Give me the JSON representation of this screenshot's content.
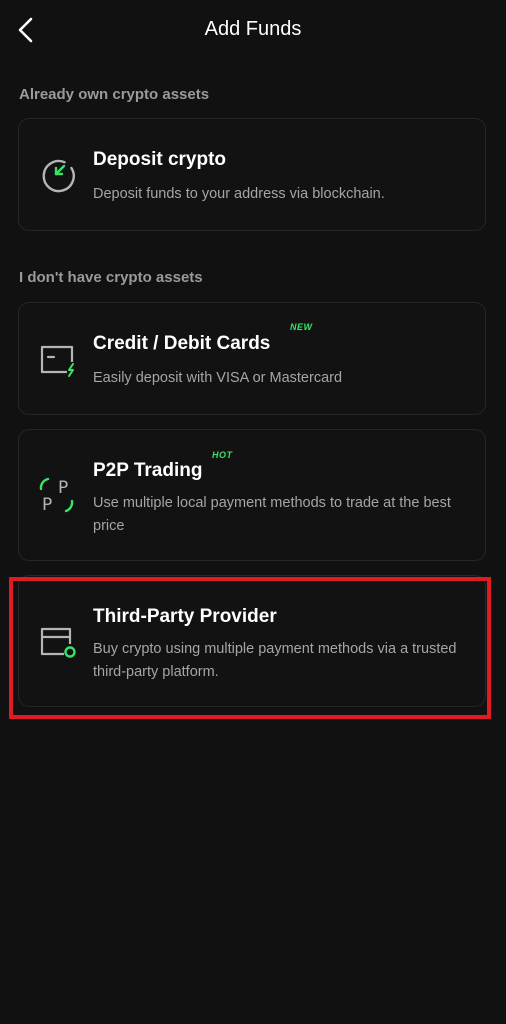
{
  "header": {
    "title": "Add Funds"
  },
  "sections": [
    {
      "label": "Already own crypto assets"
    },
    {
      "label": "I don't have crypto assets"
    }
  ],
  "options": [
    {
      "title": "Deposit crypto",
      "description": "Deposit funds to your address via blockchain.",
      "icon": "deposit-icon"
    },
    {
      "title": "Credit / Debit Cards",
      "tag": "NEW",
      "description": "Easily deposit with VISA or Mastercard",
      "icon": "card-icon"
    },
    {
      "title": "P2P Trading",
      "tag": "HOT",
      "description": "Use multiple local payment methods to trade at the best price",
      "icon": "p2p-icon"
    },
    {
      "title": "Third-Party Provider",
      "description": "Buy crypto using multiple payment methods via a trusted third-party platform.",
      "icon": "third-party-icon"
    }
  ],
  "colors": {
    "background": "#111111",
    "accent": "#39e36b",
    "highlight": "#e01b22",
    "muted_text": "#a5a5a5"
  }
}
